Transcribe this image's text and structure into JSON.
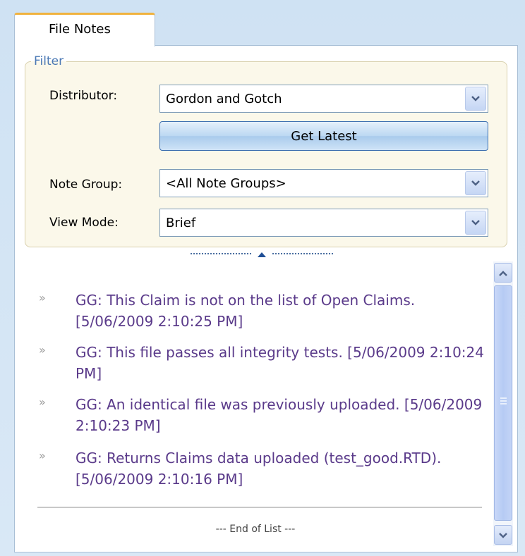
{
  "tab": {
    "label": "File Notes"
  },
  "filter": {
    "legend": "Filter",
    "distributor": {
      "label": "Distributor:",
      "value": "Gordon and Gotch"
    },
    "get_latest_label": "Get Latest",
    "note_group": {
      "label": "Note Group:",
      "value": "<All Note Groups>"
    },
    "view_mode": {
      "label": "View Mode:",
      "value": "Brief"
    }
  },
  "notes": {
    "items": [
      {
        "bullet": "»",
        "text": "GG: This Claim is not on the list of Open Claims. [5/06/2009 2:10:25 PM]"
      },
      {
        "bullet": "»",
        "text": "GG: This file passes all integrity tests. [5/06/2009 2:10:24 PM]"
      },
      {
        "bullet": "»",
        "text": "GG: An identical file was previously uploaded. [5/06/2009 2:10:23 PM]"
      },
      {
        "bullet": "»",
        "text": "GG: Returns Claims data uploaded (test_good.RTD). [5/06/2009 2:10:16 PM]"
      }
    ],
    "end_label": "--- End of List ---"
  },
  "icons": {
    "dropdown": "chevron-down-icon",
    "splitter": "collapse-up-icon",
    "scroll_up": "chevron-up-icon",
    "scroll_down": "chevron-down-icon"
  },
  "colors": {
    "tab_accent": "#f0b23e",
    "filter_background": "#fbf8ea",
    "note_text": "#5a3a8a",
    "legend_text": "#4a78b4"
  }
}
